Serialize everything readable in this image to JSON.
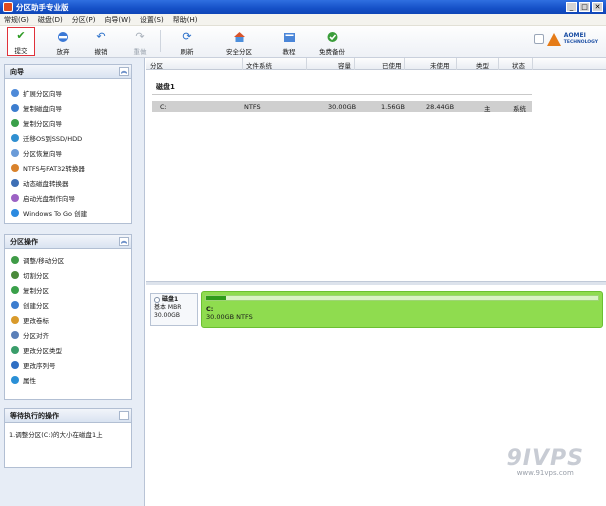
{
  "window": {
    "title": "分区助手专业版"
  },
  "menu": [
    "常规(G)",
    "磁盘(D)",
    "分区(P)",
    "向导(W)",
    "设置(S)",
    "帮助(H)"
  ],
  "toolbar": {
    "commit": "提交",
    "discard": "放弃",
    "undo": "撤销",
    "redo": "重做",
    "refresh": "刷新",
    "safe_partition": "安全分区",
    "tutorial": "教程",
    "free_backup": "免费备份"
  },
  "logo": {
    "brand": "AOMEI",
    "sub": "TECHNOLOGY"
  },
  "wizard_panel": {
    "title": "向导",
    "items": [
      "扩展分区向导",
      "复制磁盘向导",
      "复制分区向导",
      "迁移OS到SSD/HDD",
      "分区恢复向导",
      "NTFS与FAT32转换器",
      "动态磁盘转换器",
      "启动光盘制作向导",
      "Windows To Go 创建"
    ]
  },
  "ops_panel": {
    "title": "分区操作",
    "items": [
      "调整/移动分区",
      "切割分区",
      "复制分区",
      "创建分区",
      "更改卷标",
      "分区对齐",
      "更改分区类型",
      "更改序列号",
      "属性"
    ]
  },
  "pending_panel": {
    "title": "等待执行的操作",
    "items": [
      "1.调整分区(C:)的大小在磁盘1上"
    ]
  },
  "columns": [
    "分区",
    "文件系统",
    "容量",
    "已使用",
    "未使用",
    "类型",
    "状态"
  ],
  "disks": [
    {
      "name": "磁盘1",
      "partitions": [
        {
          "letter": "C:",
          "fs": "NTFS",
          "capacity": "30.00GB",
          "used": "1.56GB",
          "unused": "28.44GB",
          "type": "主",
          "status": "系统"
        }
      ]
    }
  ],
  "disk_map": {
    "name": "磁盘1",
    "kind": "基本 MBR",
    "size": "30.00GB",
    "partition_label": "C:",
    "partition_desc": "30.00GB NTFS",
    "used_fraction": 0.052
  },
  "watermark": {
    "big": "9IVPS",
    "url": "www.91vps.com"
  },
  "colors": {
    "partition_green": "#8fdc4f",
    "title_blue": "#1550c7",
    "commit_border": "#e0313a"
  }
}
